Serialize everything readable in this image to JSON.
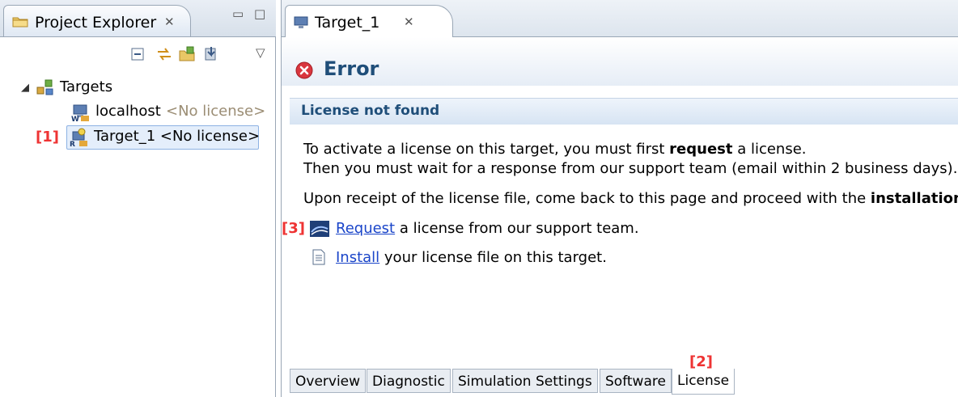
{
  "left": {
    "tab_title": "Project Explorer",
    "close_glyph": "✕",
    "minimize_glyph": "▭",
    "maximize_glyph": "□",
    "toolbar_menu_glyph": "▽",
    "tree": {
      "root": {
        "label": "Targets",
        "icon": "targets-network-icon",
        "expanded": true
      },
      "children": [
        {
          "label": "localhost",
          "status": "<No license>",
          "icon": "windows-host-icon"
        },
        {
          "label": "Target_1 <No license>",
          "icon": "realtime-target-icon",
          "selected": true
        }
      ]
    },
    "marker_1": "[1]"
  },
  "right": {
    "tab_title": "Target_1",
    "close_glyph": "✕",
    "header_title": "Error",
    "section_title": "License not found",
    "paragraph1_line1_pre": "To activate a license on this target, you must first ",
    "paragraph1_line1_bold": "request",
    "paragraph1_line1_post": " a license.",
    "paragraph1_line2": "Then you must wait for a response from our support team (email within 2 business days).",
    "paragraph2_pre": "Upon receipt of the license file, come back to this page and proceed with the ",
    "paragraph2_bold": "installation",
    "paragraph2_post": ":",
    "request_link": "Request",
    "request_rest": " a license from our support team.",
    "install_link": "Install",
    "install_rest": " your license file on this target.",
    "marker_2": "[2]",
    "marker_3": "[3]",
    "bottom_tabs": [
      "Overview",
      "Diagnostic",
      "Simulation Settings",
      "Software",
      "License"
    ],
    "active_bottom_tab": "License"
  },
  "colors": {
    "accent_title": "#1f4e79",
    "link": "#1a45c9",
    "marker_red": "#e33333",
    "error_red": "#d9363e",
    "muted_status": "#9b8d74"
  }
}
